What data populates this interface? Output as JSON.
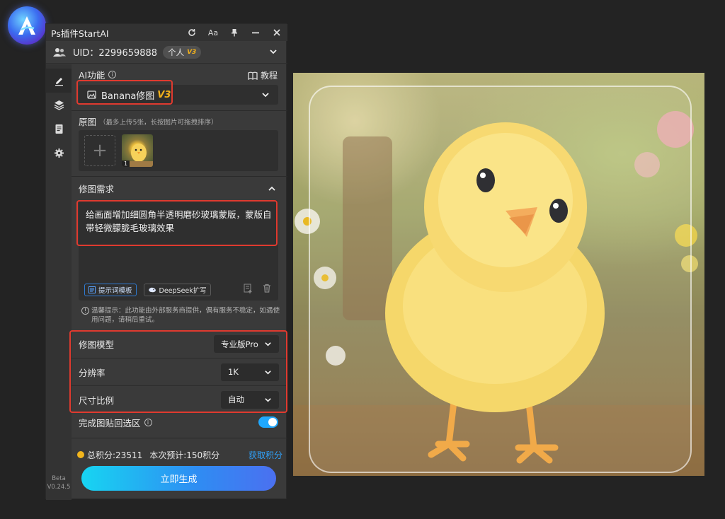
{
  "window": {
    "title": "Ps插件StartAI",
    "buttons": {
      "refresh": "refresh-icon",
      "font": "Aa",
      "pin": "pin-icon",
      "minimize": "minimize-icon",
      "close": "close-icon"
    }
  },
  "account": {
    "uid": "UID：2299659888",
    "plan": "个人",
    "plan_version": "V3"
  },
  "ai_function": {
    "heading": "AI功能",
    "tutorial": "教程",
    "selected": "Banana修图",
    "version": "V3"
  },
  "original": {
    "heading": "原图",
    "hint": "（最多上传5张，长按图片可拖拽排序）",
    "images": [
      {
        "index": "1"
      }
    ]
  },
  "request": {
    "heading": "修图需求",
    "text": "给画面增加细圆角半透明磨砂玻璃蒙版，蒙版自带轻微朦胧毛玻璃效果",
    "template_button": "提示词模板",
    "deepseek_button": "DeepSeek扩写"
  },
  "warning": "温馨提示：此功能由外部服务商提供，偶有服务不稳定，如遇使用问题，请稍后重试。",
  "settings": {
    "model": {
      "label": "修图模型",
      "value": "专业版Pro"
    },
    "resolution": {
      "label": "分辨率",
      "value": "1K"
    },
    "ratio": {
      "label": "尺寸比例",
      "value": "自动"
    }
  },
  "paste_back": {
    "label": "完成图贴回选区",
    "enabled": true
  },
  "points": {
    "total": "总积分:23511",
    "estimate": "本次预计:150积分",
    "get": "获取积分"
  },
  "generate_button": "立即生成",
  "version": {
    "line1": "Beta",
    "line2": "V0.24.5"
  },
  "colors": {
    "accent": "#1fa8ff",
    "highlight": "#e03a2f",
    "gold": "#f3b21b"
  }
}
